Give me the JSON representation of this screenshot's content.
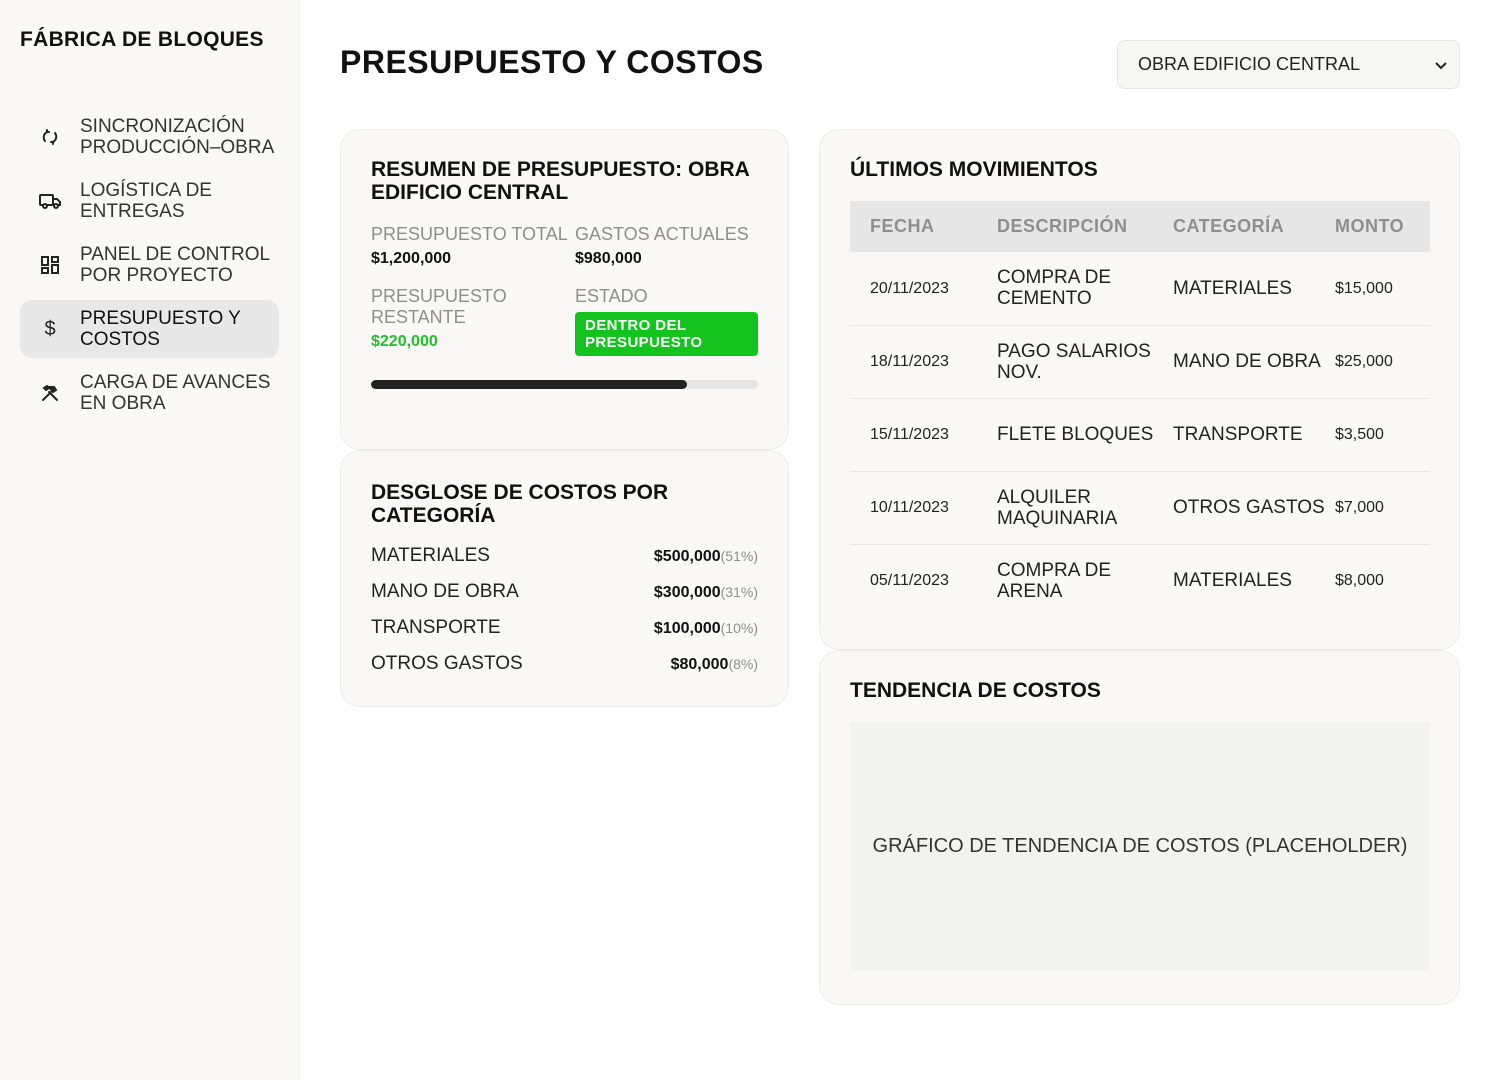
{
  "sidebar": {
    "brand": "FÁBRICA DE BLOQUES",
    "items": [
      {
        "label": "SINCRONIZACIÓN PRODUCCIÓN–OBRA",
        "icon": "sync-icon",
        "active": false
      },
      {
        "label": "LOGÍSTICA DE ENTREGAS",
        "icon": "truck-icon",
        "active": false
      },
      {
        "label": "PANEL DE CONTROL POR PROYECTO",
        "icon": "dashboard-icon",
        "active": false
      },
      {
        "label": "PRESUPUESTO Y COSTOS",
        "icon": "dollar-icon",
        "active": true
      },
      {
        "label": "CARGA DE AVANCES EN OBRA",
        "icon": "tools-icon",
        "active": false
      }
    ]
  },
  "header": {
    "title": "PRESUPUESTO Y COSTOS",
    "project_selected": "OBRA EDIFICIO CENTRAL"
  },
  "summary": {
    "title": "RESUMEN DE PRESUPUESTO: OBRA EDIFICIO CENTRAL",
    "total_label": "PRESUPUESTO TOTAL",
    "total_value": "$1,200,000",
    "spent_label": "GASTOS ACTUALES",
    "spent_value": "$980,000",
    "remaining_label": "PRESUPUESTO RESTANTE",
    "remaining_value": "$220,000",
    "status_label": "ESTADO",
    "status_value": "DENTRO DEL PRESUPUESTO",
    "progress_percent": 81.7
  },
  "breakdown": {
    "title": "DESGLOSE DE COSTOS POR CATEGORÍA",
    "items": [
      {
        "name": "MATERIALES",
        "amount": "$500,000",
        "pct": "(51%)"
      },
      {
        "name": "MANO DE OBRA",
        "amount": "$300,000",
        "pct": "(31%)"
      },
      {
        "name": "TRANSPORTE",
        "amount": "$100,000",
        "pct": "(10%)"
      },
      {
        "name": "OTROS GASTOS",
        "amount": "$80,000",
        "pct": "(8%)"
      }
    ]
  },
  "movements": {
    "title": "ÚLTIMOS MOVIMIENTOS",
    "headers": [
      "FECHA",
      "DESCRIPCIÓN",
      "CATEGORÍA",
      "MONTO"
    ],
    "rows": [
      {
        "date": "20/11/2023",
        "desc": "COMPRA DE CEMENTO",
        "cat": "MATERIALES",
        "amount": "$15,000"
      },
      {
        "date": "18/11/2023",
        "desc": "PAGO SALARIOS NOV.",
        "cat": "MANO DE OBRA",
        "amount": "$25,000"
      },
      {
        "date": "15/11/2023",
        "desc": "FLETE BLOQUES",
        "cat": "TRANSPORTE",
        "amount": "$3,500"
      },
      {
        "date": "10/11/2023",
        "desc": "ALQUILER MAQUINARIA",
        "cat": "OTROS GASTOS",
        "amount": "$7,000"
      },
      {
        "date": "05/11/2023",
        "desc": "COMPRA DE ARENA",
        "cat": "MATERIALES",
        "amount": "$8,000"
      }
    ]
  },
  "trend": {
    "title": "TENDENCIA DE COSTOS",
    "placeholder": "GRÁFICO DE TENDENCIA DE COSTOS (PLACEHOLDER)"
  },
  "colors": {
    "accent_green": "#14c41e",
    "remaining_green": "#22c02a",
    "progress_dark": "#222222"
  }
}
